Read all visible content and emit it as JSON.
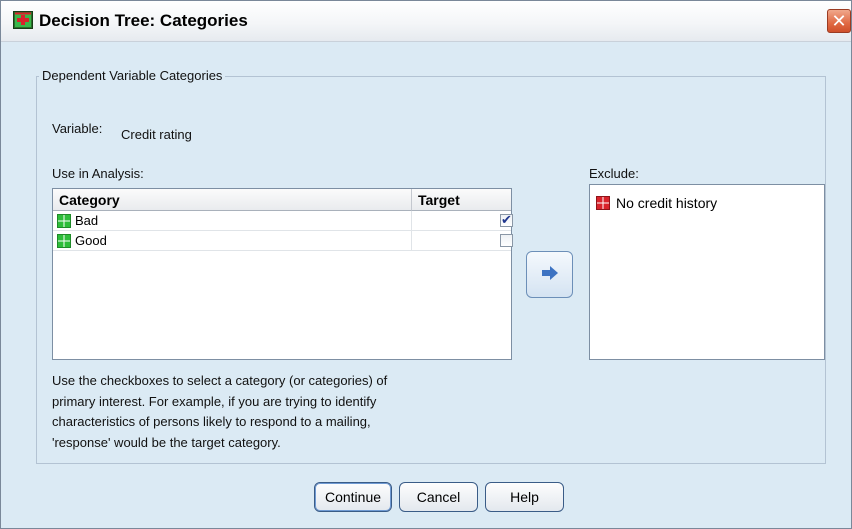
{
  "window": {
    "title": "Decision Tree: Categories",
    "close_glyph": "✕"
  },
  "group": {
    "legend": "Dependent Variable Categories"
  },
  "variable": {
    "label": "Variable:",
    "value": "Credit rating"
  },
  "use_in_analysis": {
    "label": "Use in Analysis:",
    "columns": [
      "Category",
      "Target"
    ],
    "rows": [
      {
        "category": "Bad",
        "target": true
      },
      {
        "category": "Good",
        "target": false
      }
    ]
  },
  "exclude": {
    "label": "Exclude:",
    "items": [
      "No credit history"
    ]
  },
  "help_text": {
    "lines": [
      "Use the checkboxes to select a category (or categories) of",
      "primary interest. For example, if you are trying to identify",
      "characteristics of persons likely to respond to a mailing,",
      "'response' would be the target category."
    ]
  },
  "buttons": {
    "continue": "Continue",
    "cancel": "Cancel",
    "help": "Help"
  },
  "colors": {
    "dialog_bg": "#dbeaf4",
    "green_category": "#2ebd3a",
    "red_excluded": "#d9232b",
    "tick": "#21378e"
  },
  "icons": {
    "title": "decision-tree-icon",
    "category": "green-category-icon",
    "excluded": "red-excluded-icon",
    "move": "right-arrow-icon"
  }
}
